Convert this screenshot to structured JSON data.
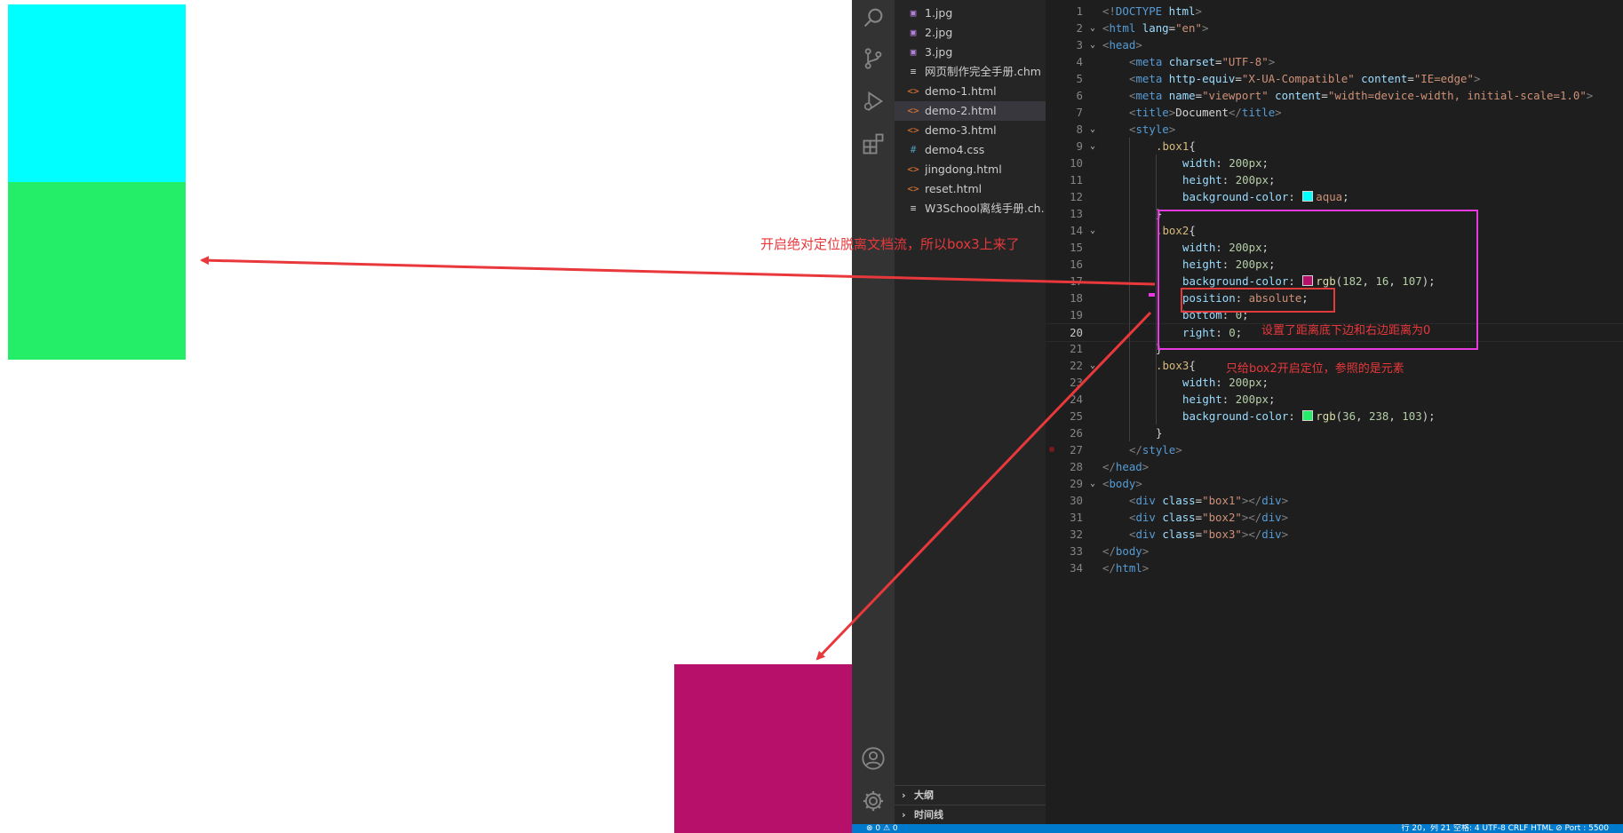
{
  "preview": {
    "box1_color": "#00ffff",
    "box2_color": "#b6106b",
    "box3_color": "#24ee67"
  },
  "explorer": {
    "files": [
      {
        "icon": "image-file-icon",
        "glyph": "▣",
        "kind": "img",
        "name": "1.jpg"
      },
      {
        "icon": "image-file-icon",
        "glyph": "▣",
        "kind": "img",
        "name": "2.jpg"
      },
      {
        "icon": "image-file-icon",
        "glyph": "▣",
        "kind": "img",
        "name": "3.jpg"
      },
      {
        "icon": "document-file-icon",
        "glyph": "≡",
        "kind": "doc",
        "name": "网页制作完全手册.chm"
      },
      {
        "icon": "html-file-icon",
        "glyph": "<>",
        "kind": "html",
        "name": "demo-1.html"
      },
      {
        "icon": "html-file-icon",
        "glyph": "<>",
        "kind": "html",
        "name": "demo-2.html",
        "active": true
      },
      {
        "icon": "html-file-icon",
        "glyph": "<>",
        "kind": "html",
        "name": "demo-3.html"
      },
      {
        "icon": "css-file-icon",
        "glyph": "#",
        "kind": "css",
        "name": "demo4.css"
      },
      {
        "icon": "html-file-icon",
        "glyph": "<>",
        "kind": "html",
        "name": "jingdong.html"
      },
      {
        "icon": "html-file-icon",
        "glyph": "<>",
        "kind": "html",
        "name": "reset.html"
      },
      {
        "icon": "document-file-icon",
        "glyph": "≡",
        "kind": "doc",
        "name": "W3School离线手册.ch..."
      }
    ],
    "outline_label": "大纲",
    "timeline_label": "时间线",
    "chevron": "›"
  },
  "editor": {
    "current_line": 20,
    "lines": [
      {
        "n": "1",
        "fold": "",
        "indent": 0,
        "tokens": [
          [
            "t-punct",
            "<!"
          ],
          [
            "t-tag",
            "DOCTYPE"
          ],
          [
            "t-text",
            " "
          ],
          [
            "t-attr",
            "html"
          ],
          [
            "t-punct",
            ">"
          ]
        ]
      },
      {
        "n": "2",
        "fold": "⌄",
        "indent": 0,
        "tokens": [
          [
            "t-punct",
            "<"
          ],
          [
            "t-tag",
            "html"
          ],
          [
            "t-text",
            " "
          ],
          [
            "t-attr",
            "lang"
          ],
          [
            "t-text",
            "="
          ],
          [
            "t-str",
            "\"en\""
          ],
          [
            "t-punct",
            ">"
          ]
        ]
      },
      {
        "n": "3",
        "fold": "⌄",
        "indent": 0,
        "tokens": [
          [
            "t-punct",
            "<"
          ],
          [
            "t-tag",
            "head"
          ],
          [
            "t-punct",
            ">"
          ]
        ]
      },
      {
        "n": "4",
        "fold": "",
        "indent": 1,
        "tokens": [
          [
            "t-punct",
            "<"
          ],
          [
            "t-tag",
            "meta"
          ],
          [
            "t-text",
            " "
          ],
          [
            "t-attr",
            "charset"
          ],
          [
            "t-text",
            "="
          ],
          [
            "t-str",
            "\"UTF-8\""
          ],
          [
            "t-punct",
            ">"
          ]
        ]
      },
      {
        "n": "5",
        "fold": "",
        "indent": 1,
        "tokens": [
          [
            "t-punct",
            "<"
          ],
          [
            "t-tag",
            "meta"
          ],
          [
            "t-text",
            " "
          ],
          [
            "t-attr",
            "http-equiv"
          ],
          [
            "t-text",
            "="
          ],
          [
            "t-str",
            "\"X-UA-Compatible\""
          ],
          [
            "t-text",
            " "
          ],
          [
            "t-attr",
            "content"
          ],
          [
            "t-text",
            "="
          ],
          [
            "t-str",
            "\"IE=edge\""
          ],
          [
            "t-punct",
            ">"
          ]
        ]
      },
      {
        "n": "6",
        "fold": "",
        "indent": 1,
        "tokens": [
          [
            "t-punct",
            "<"
          ],
          [
            "t-tag",
            "meta"
          ],
          [
            "t-text",
            " "
          ],
          [
            "t-attr",
            "name"
          ],
          [
            "t-text",
            "="
          ],
          [
            "t-str",
            "\"viewport\""
          ],
          [
            "t-text",
            " "
          ],
          [
            "t-attr",
            "content"
          ],
          [
            "t-text",
            "="
          ],
          [
            "t-str",
            "\"width=device-width, initial-scale=1.0\""
          ],
          [
            "t-punct",
            ">"
          ]
        ]
      },
      {
        "n": "7",
        "fold": "",
        "indent": 1,
        "tokens": [
          [
            "t-punct",
            "<"
          ],
          [
            "t-tag",
            "title"
          ],
          [
            "t-punct",
            ">"
          ],
          [
            "t-text",
            "Document"
          ],
          [
            "t-punct",
            "</"
          ],
          [
            "t-tag",
            "title"
          ],
          [
            "t-punct",
            ">"
          ]
        ]
      },
      {
        "n": "8",
        "fold": "⌄",
        "indent": 1,
        "tokens": [
          [
            "t-punct",
            "<"
          ],
          [
            "t-tag",
            "style"
          ],
          [
            "t-punct",
            ">"
          ]
        ]
      },
      {
        "n": "9",
        "fold": "⌄",
        "indent": 2,
        "tokens": [
          [
            "t-sel",
            ".box1"
          ],
          [
            "t-text",
            "{"
          ]
        ]
      },
      {
        "n": "10",
        "fold": "",
        "indent": 3,
        "tokens": [
          [
            "t-prop",
            "width"
          ],
          [
            "t-text",
            ": "
          ],
          [
            "t-num",
            "200px"
          ],
          [
            "t-text",
            ";"
          ]
        ]
      },
      {
        "n": "11",
        "fold": "",
        "indent": 3,
        "tokens": [
          [
            "t-prop",
            "height"
          ],
          [
            "t-text",
            ": "
          ],
          [
            "t-num",
            "200px"
          ],
          [
            "t-text",
            ";"
          ]
        ]
      },
      {
        "n": "12",
        "fold": "",
        "indent": 3,
        "tokens": [
          [
            "t-prop",
            "background-color"
          ],
          [
            "t-text",
            ": "
          ],
          [
            "swatch",
            "#00ffff"
          ],
          [
            "t-val",
            "aqua"
          ],
          [
            "t-text",
            ";"
          ]
        ]
      },
      {
        "n": "13",
        "fold": "",
        "indent": 2,
        "tokens": [
          [
            "t-text",
            "}"
          ]
        ]
      },
      {
        "n": "14",
        "fold": "⌄",
        "indent": 2,
        "tokens": [
          [
            "t-sel",
            ".box2"
          ],
          [
            "t-text",
            "{"
          ]
        ]
      },
      {
        "n": "15",
        "fold": "",
        "indent": 3,
        "tokens": [
          [
            "t-prop",
            "width"
          ],
          [
            "t-text",
            ": "
          ],
          [
            "t-num",
            "200px"
          ],
          [
            "t-text",
            ";"
          ]
        ]
      },
      {
        "n": "16",
        "fold": "",
        "indent": 3,
        "tokens": [
          [
            "t-prop",
            "height"
          ],
          [
            "t-text",
            ": "
          ],
          [
            "t-num",
            "200px"
          ],
          [
            "t-text",
            ";"
          ]
        ]
      },
      {
        "n": "17",
        "fold": "",
        "indent": 3,
        "tokens": [
          [
            "t-prop",
            "background-color"
          ],
          [
            "t-text",
            ": "
          ],
          [
            "swatch",
            "#b6106b"
          ],
          [
            "t-fn",
            "rgb"
          ],
          [
            "t-text",
            "("
          ],
          [
            "t-num",
            "182"
          ],
          [
            "t-text",
            ", "
          ],
          [
            "t-num",
            "16"
          ],
          [
            "t-text",
            ", "
          ],
          [
            "t-num",
            "107"
          ],
          [
            "t-text",
            ");"
          ]
        ]
      },
      {
        "n": "18",
        "fold": "",
        "indent": 3,
        "tokens": [
          [
            "t-prop",
            "position"
          ],
          [
            "t-text",
            ": "
          ],
          [
            "t-val",
            "absolute"
          ],
          [
            "t-text",
            ";"
          ]
        ]
      },
      {
        "n": "19",
        "fold": "",
        "indent": 3,
        "tokens": [
          [
            "t-prop",
            "bottom"
          ],
          [
            "t-text",
            ": "
          ],
          [
            "t-num",
            "0"
          ],
          [
            "t-text",
            ";"
          ]
        ]
      },
      {
        "n": "20",
        "fold": "",
        "indent": 3,
        "tokens": [
          [
            "t-prop",
            "right"
          ],
          [
            "t-text",
            ": "
          ],
          [
            "t-num",
            "0"
          ],
          [
            "t-text",
            ";"
          ]
        ]
      },
      {
        "n": "21",
        "fold": "",
        "indent": 2,
        "tokens": [
          [
            "t-text",
            "}"
          ]
        ]
      },
      {
        "n": "22",
        "fold": "⌄",
        "indent": 2,
        "tokens": [
          [
            "t-sel",
            ".box3"
          ],
          [
            "t-text",
            "{"
          ]
        ]
      },
      {
        "n": "23",
        "fold": "",
        "indent": 3,
        "tokens": [
          [
            "t-prop",
            "width"
          ],
          [
            "t-text",
            ": "
          ],
          [
            "t-num",
            "200px"
          ],
          [
            "t-text",
            ";"
          ]
        ]
      },
      {
        "n": "24",
        "fold": "",
        "indent": 3,
        "tokens": [
          [
            "t-prop",
            "height"
          ],
          [
            "t-text",
            ": "
          ],
          [
            "t-num",
            "200px"
          ],
          [
            "t-text",
            ";"
          ]
        ]
      },
      {
        "n": "25",
        "fold": "",
        "indent": 3,
        "tokens": [
          [
            "t-prop",
            "background-color"
          ],
          [
            "t-text",
            ": "
          ],
          [
            "swatch",
            "#24ee67"
          ],
          [
            "t-fn",
            "rgb"
          ],
          [
            "t-text",
            "("
          ],
          [
            "t-num",
            "36"
          ],
          [
            "t-text",
            ", "
          ],
          [
            "t-num",
            "238"
          ],
          [
            "t-text",
            ", "
          ],
          [
            "t-num",
            "103"
          ],
          [
            "t-text",
            ");"
          ]
        ]
      },
      {
        "n": "26",
        "fold": "",
        "indent": 2,
        "tokens": [
          [
            "t-text",
            "}"
          ]
        ]
      },
      {
        "n": "27",
        "fold": "",
        "indent": 1,
        "tokens": [
          [
            "t-punct",
            "</"
          ],
          [
            "t-tag",
            "style"
          ],
          [
            "t-punct",
            ">"
          ]
        ]
      },
      {
        "n": "28",
        "fold": "",
        "indent": 0,
        "tokens": [
          [
            "t-punct",
            "</"
          ],
          [
            "t-tag",
            "head"
          ],
          [
            "t-punct",
            ">"
          ]
        ]
      },
      {
        "n": "29",
        "fold": "⌄",
        "indent": 0,
        "tokens": [
          [
            "t-punct",
            "<"
          ],
          [
            "t-tag",
            "body"
          ],
          [
            "t-punct",
            ">"
          ]
        ]
      },
      {
        "n": "30",
        "fold": "",
        "indent": 1,
        "tokens": [
          [
            "t-punct",
            "<"
          ],
          [
            "t-tag",
            "div"
          ],
          [
            "t-text",
            " "
          ],
          [
            "t-attr",
            "class"
          ],
          [
            "t-text",
            "="
          ],
          [
            "t-str",
            "\"box1\""
          ],
          [
            "t-punct",
            "></"
          ],
          [
            "t-tag",
            "div"
          ],
          [
            "t-punct",
            ">"
          ]
        ]
      },
      {
        "n": "31",
        "fold": "",
        "indent": 1,
        "tokens": [
          [
            "t-punct",
            "<"
          ],
          [
            "t-tag",
            "div"
          ],
          [
            "t-text",
            " "
          ],
          [
            "t-attr",
            "class"
          ],
          [
            "t-text",
            "="
          ],
          [
            "t-str",
            "\"box2\""
          ],
          [
            "t-punct",
            "></"
          ],
          [
            "t-tag",
            "div"
          ],
          [
            "t-punct",
            ">"
          ]
        ]
      },
      {
        "n": "32",
        "fold": "",
        "indent": 1,
        "tokens": [
          [
            "t-punct",
            "<"
          ],
          [
            "t-tag",
            "div"
          ],
          [
            "t-text",
            " "
          ],
          [
            "t-attr",
            "class"
          ],
          [
            "t-text",
            "="
          ],
          [
            "t-str",
            "\"box3\""
          ],
          [
            "t-punct",
            "></"
          ],
          [
            "t-tag",
            "div"
          ],
          [
            "t-punct",
            ">"
          ]
        ]
      },
      {
        "n": "33",
        "fold": "",
        "indent": 0,
        "tokens": [
          [
            "t-punct",
            "</"
          ],
          [
            "t-tag",
            "body"
          ],
          [
            "t-punct",
            ">"
          ]
        ]
      },
      {
        "n": "34",
        "fold": "",
        "indent": 0,
        "tokens": [
          [
            "t-punct",
            "</"
          ],
          [
            "t-tag",
            "html"
          ],
          [
            "t-punct",
            ">"
          ]
        ]
      }
    ]
  },
  "annotations": {
    "note_left": "开启绝对定位脱离文档流，所以box3上来了",
    "note_right": "设置了距离底下边和右边距离为0",
    "note_box3": "只给box2开启定位，参照的是元素",
    "arrow_color": "#e8383b",
    "highlight_color": "#e63ae0",
    "box_color": "#e03a3a"
  },
  "statusbar": {
    "left": "⊗ 0  ⚠ 0",
    "right": "行 20，列 21    空格: 4    UTF-8    CRLF    HTML    ⊘ Port : 5500"
  }
}
